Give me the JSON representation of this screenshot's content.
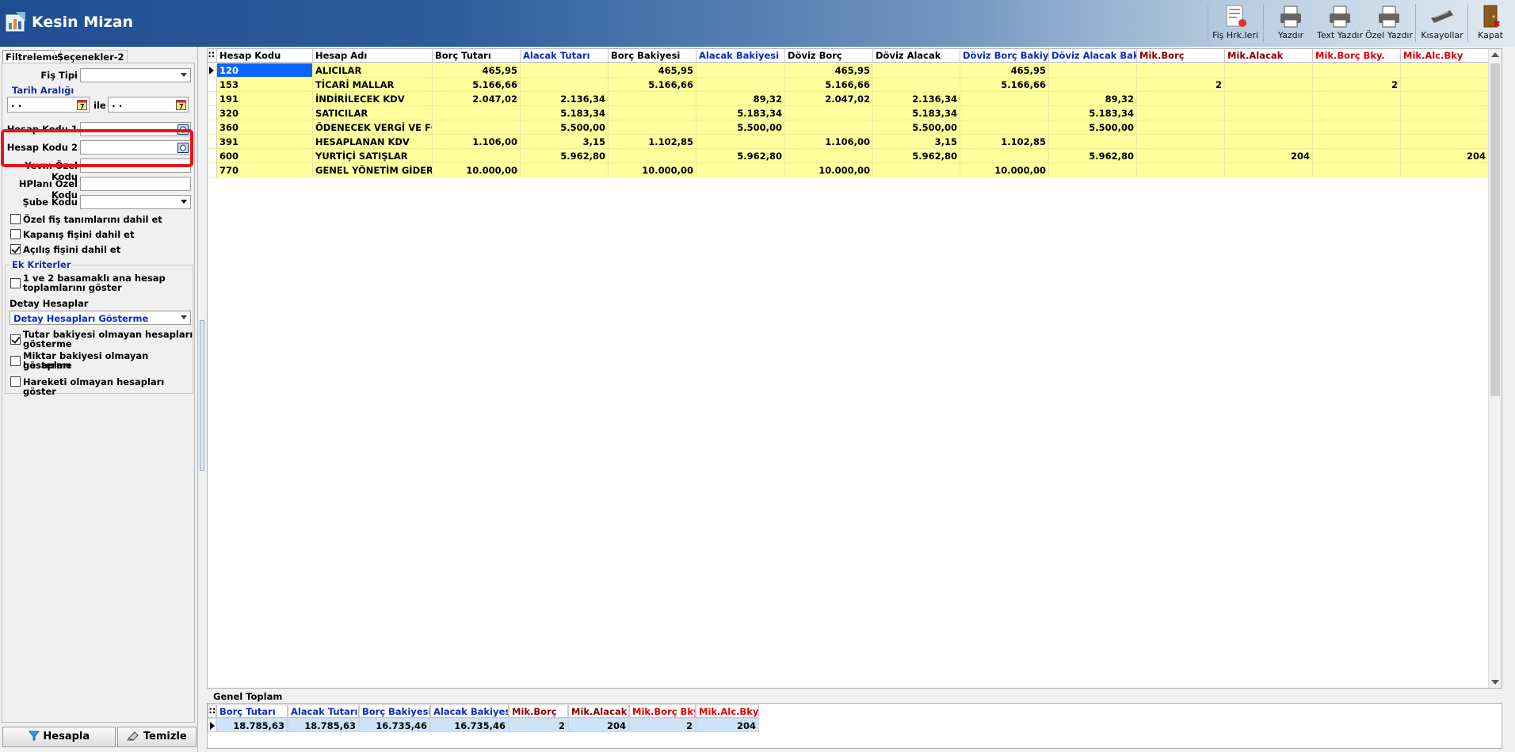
{
  "window": {
    "title": "Kesin Mizan"
  },
  "toolbar": {
    "fis_hrk": "Fiş Hrk.leri",
    "yazdir": "Yazdır",
    "text_yazdir": "Text Yazdır",
    "ozel_yazdir": "Özel Yazdır",
    "kisayollar": "Kısayollar",
    "kapat": "Kapat"
  },
  "tabs": {
    "filtreleme": "Filtreleme",
    "secenekler": "Seçenekler-2"
  },
  "filters": {
    "fis_tipi_label": "Fiş Tipi",
    "fis_tipi_value": "",
    "tarih_araligi": "Tarih Aralığı",
    "date_start": " .  .",
    "date_end": " .  .",
    "ile": "ile",
    "hesap_kodu1": "Hesap Kodu 1",
    "hesap_kodu2": "Hesap Kodu 2",
    "yevm_ozel_kodu": "Yevm Özel Kodu",
    "hplani_ozel_kodu": "HPlanı Özel Kodu",
    "sube_kodu": "Şube Kodu",
    "ozel_fis": "Özel fiş tanımlarını dahil et",
    "kapanis": "Kapanış fişini dahil et",
    "acilis": "Açılış fişini dahil et",
    "ozel_fis_checked": false,
    "kapanis_checked": false,
    "acilis_checked": true
  },
  "ek_kriterler": {
    "title": "Ek Kriterler",
    "ana_hesap_line1": "1 ve 2 basamaklı ana hesap",
    "ana_hesap_line2": "toplamlarını göster",
    "detay_label": "Detay Hesaplar",
    "detay_value": "Detay Hesapları Gösterme",
    "tutar_line1": "Tutar bakiyesi olmayan hesapları",
    "tutar_line2": "gösterme",
    "miktar_line1": "Miktar bakiyesi olmayan hesapları",
    "miktar_line2": "gösterme",
    "hareketi": "Hareketi olmayan hesapları göster",
    "ana_hesap_checked": false,
    "tutar_checked": true,
    "miktar_checked": false,
    "hareketi_checked": false
  },
  "buttons": {
    "hesapla": "Hesapla",
    "temizle": "Temizle"
  },
  "grid": {
    "columns": [
      "Hesap Kodu",
      "Hesap Adı",
      "Borç Tutarı",
      "Alacak Tutarı",
      "Borç Bakiyesi",
      "Alacak Bakiyesi",
      "Döviz Borç",
      "Döviz Alacak",
      "Döviz Borç Bakiye",
      "Döviz Alacak Bak...",
      "Mik.Borç",
      "Mik.Alacak",
      "Mik.Borç Bky.",
      "Mik.Alc.Bky"
    ],
    "rows": [
      [
        "120",
        "ALICILAR",
        "465,95",
        "",
        "465,95",
        "",
        "465,95",
        "",
        "465,95",
        "",
        "",
        "",
        "",
        ""
      ],
      [
        "153",
        "TİCARİ MALLAR",
        "5.166,66",
        "",
        "5.166,66",
        "",
        "5.166,66",
        "",
        "5.166,66",
        "",
        "2",
        "",
        "2",
        ""
      ],
      [
        "191",
        "İNDİRİLECEK KDV",
        "2.047,02",
        "2.136,34",
        "",
        "89,32",
        "2.047,02",
        "2.136,34",
        "",
        "89,32",
        "",
        "",
        "",
        ""
      ],
      [
        "320",
        "SATICILAR",
        "",
        "5.183,34",
        "",
        "5.183,34",
        "",
        "5.183,34",
        "",
        "5.183,34",
        "",
        "",
        "",
        ""
      ],
      [
        "360",
        "ÖDENECEK VERGİ VE FONLA",
        "",
        "5.500,00",
        "",
        "5.500,00",
        "",
        "5.500,00",
        "",
        "5.500,00",
        "",
        "",
        "",
        ""
      ],
      [
        "391",
        "HESAPLANAN KDV",
        "1.106,00",
        "3,15",
        "1.102,85",
        "",
        "1.106,00",
        "3,15",
        "1.102,85",
        "",
        "",
        "",
        "",
        ""
      ],
      [
        "600",
        "YURTİÇİ SATIŞLAR",
        "",
        "5.962,80",
        "",
        "5.962,80",
        "",
        "5.962,80",
        "",
        "5.962,80",
        "",
        "204",
        "",
        "204"
      ],
      [
        "770",
        "GENEL YÖNETİM GİDERLERİ",
        "10.000,00",
        "",
        "10.000,00",
        "",
        "10.000,00",
        "",
        "10.000,00",
        "",
        "",
        "",
        "",
        ""
      ]
    ]
  },
  "footer": {
    "title": "Genel Toplam",
    "columns": [
      "Borç Tutarı",
      "Alacak Tutarı",
      "Borç Bakiyesi",
      "Alacak Bakiyesi",
      "Mik.Borç",
      "Mik.Alacak",
      "Mik.Borç Bky.",
      "Mik.Alc.Bky."
    ],
    "values": [
      "18.785,63",
      "18.785,63",
      "16.735,46",
      "16.735,46",
      "2",
      "204",
      "2",
      "204"
    ]
  },
  "colors": {
    "highlight": "#e8131b",
    "row_bg": "#ffff9e",
    "selected": "#0a64ff"
  }
}
